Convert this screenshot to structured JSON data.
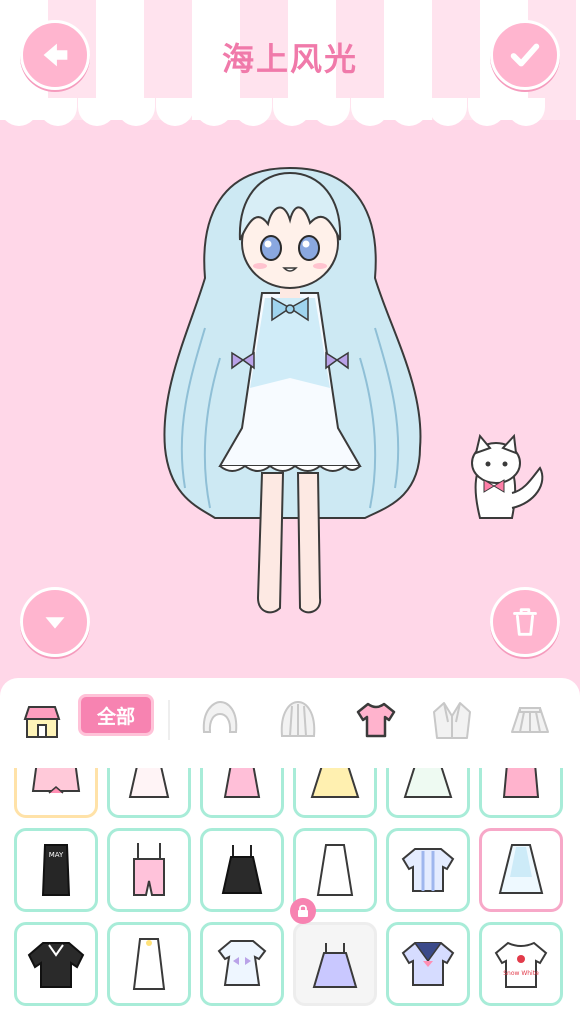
{
  "header": {
    "title": "海上风光"
  },
  "buttons": {
    "back_icon": "arrow-left-icon",
    "confirm_icon": "checkmark-icon",
    "collapse_icon": "chevron-down-icon",
    "delete_icon": "trash-icon"
  },
  "tabs": {
    "shop_icon": "shop-icon",
    "all_label": "全部",
    "categories": [
      "front-hair-icon",
      "back-hair-icon",
      "top-icon",
      "jacket-icon",
      "skirt-icon"
    ],
    "selected": "top-icon"
  },
  "colors": {
    "background": "#ffd7e8",
    "accent": "#f783b1",
    "title": "#f07aaa",
    "cell_border": "#a8ecd8",
    "selected_border": "#f7a8c8"
  },
  "grid": {
    "rows": [
      [
        "pink-ribbon-top",
        "white-dress",
        "pink-dress",
        "yellow-dress",
        "mint-dress",
        "pink-overall-dress"
      ],
      [
        "black-may-tshirt",
        "pink-overalls",
        "black-pinafore",
        "white-nightgown",
        "blue-striped-shirt",
        "white-blue-dress"
      ],
      [
        "black-lace-blouse",
        "white-slip-dress",
        "white-blue-frill-dress",
        "lavender-dress",
        "navy-sailor-top",
        "snow-white-tshirt"
      ]
    ],
    "selected_item": "white-blue-dress",
    "locked_item": "lavender-dress",
    "tshirt_text": "MAY",
    "snow_white_text": "Snow White"
  }
}
